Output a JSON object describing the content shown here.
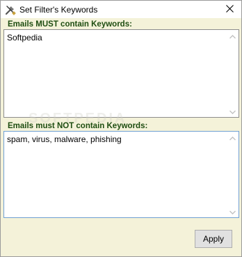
{
  "window": {
    "title": "Set Filter's Keywords",
    "title_icon": "wrench-screwdriver-icon",
    "close_icon": "close-icon"
  },
  "must_contain": {
    "label": "Emails MUST contain Keywords:",
    "value": "Softpedia"
  },
  "must_not_contain": {
    "label": "Emails must NOT contain Keywords:",
    "value": "spam, virus, malware, phishing"
  },
  "watermark": "SOFTPEDIA",
  "buttons": {
    "apply_label": "Apply"
  },
  "colors": {
    "client_background": "#f4f2d9",
    "label_color": "#1e4d11",
    "focused_border": "#6f9fd3"
  }
}
